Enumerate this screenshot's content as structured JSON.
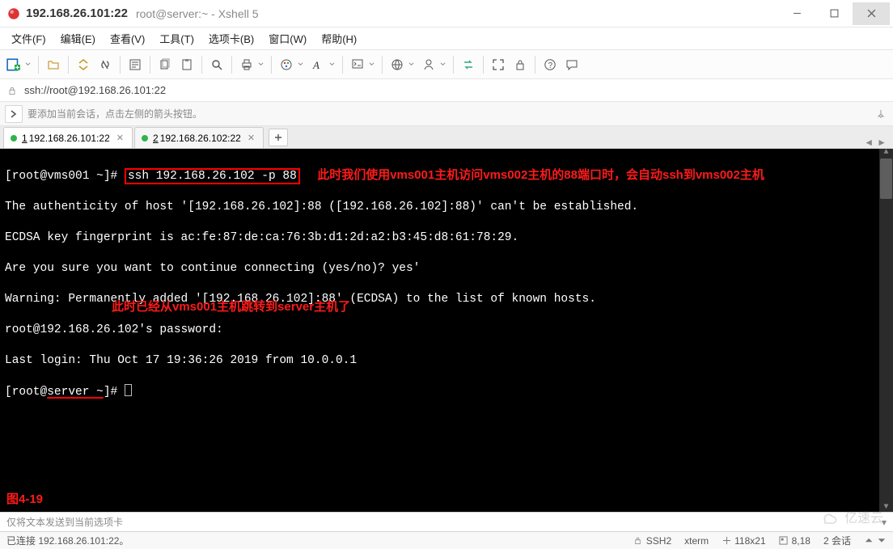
{
  "title": {
    "host": "192.168.26.101:22",
    "suffix": "root@server:~ - Xshell 5"
  },
  "menu": {
    "file": "文件(F)",
    "edit": "编辑(E)",
    "view": "查看(V)",
    "tools": "工具(T)",
    "tabs": "选项卡(B)",
    "window": "窗口(W)",
    "help": "帮助(H)"
  },
  "address": {
    "url": "ssh://root@192.168.26.101:22"
  },
  "hint": {
    "text": "要添加当前会话，点击左侧的箭头按钮。"
  },
  "tabs": {
    "t1_num": "1",
    "t1_label": " 192.168.26.101:22",
    "t2_num": "2",
    "t2_label": " 192.168.26.102:22"
  },
  "term": {
    "prompt1": "[root@vms001 ~]# ",
    "cmd1": "ssh 192.168.26.102 -p 88",
    "ann1": "此时我们使用vms001主机访问vms002主机的88端口时，会自动ssh到vms002主机",
    "l2": "The authenticity of host '[192.168.26.102]:88 ([192.168.26.102]:88)' can't be established.",
    "l3": "ECDSA key fingerprint is ac:fe:87:de:ca:76:3b:d1:2d:a2:b3:45:d8:61:78:29.",
    "l4": "Are you sure you want to continue connecting (yes/no)? yes'",
    "l5": "Warning: Permanently added '[192.168.26.102]:88' (ECDSA) to the list of known hosts.",
    "l6": "root@192.168.26.102's password:",
    "l7": "Last login: Thu Oct 17 19:36:26 2019 from 10.0.0.1",
    "p8a": "[root@",
    "p8b": "server ~",
    "p8c": "]# ",
    "ann2": "此时已经从vms001主机跳转到server主机了",
    "fig": "图4-19"
  },
  "input_status": "仅将文本发送到当前选项卡",
  "status": {
    "conn": "已连接 192.168.26.101:22。",
    "proto": "SSH2",
    "termtype": "xterm",
    "size": "118x21",
    "cursor": "8,18",
    "sessions": "2 会话"
  },
  "watermark": "亿速云"
}
